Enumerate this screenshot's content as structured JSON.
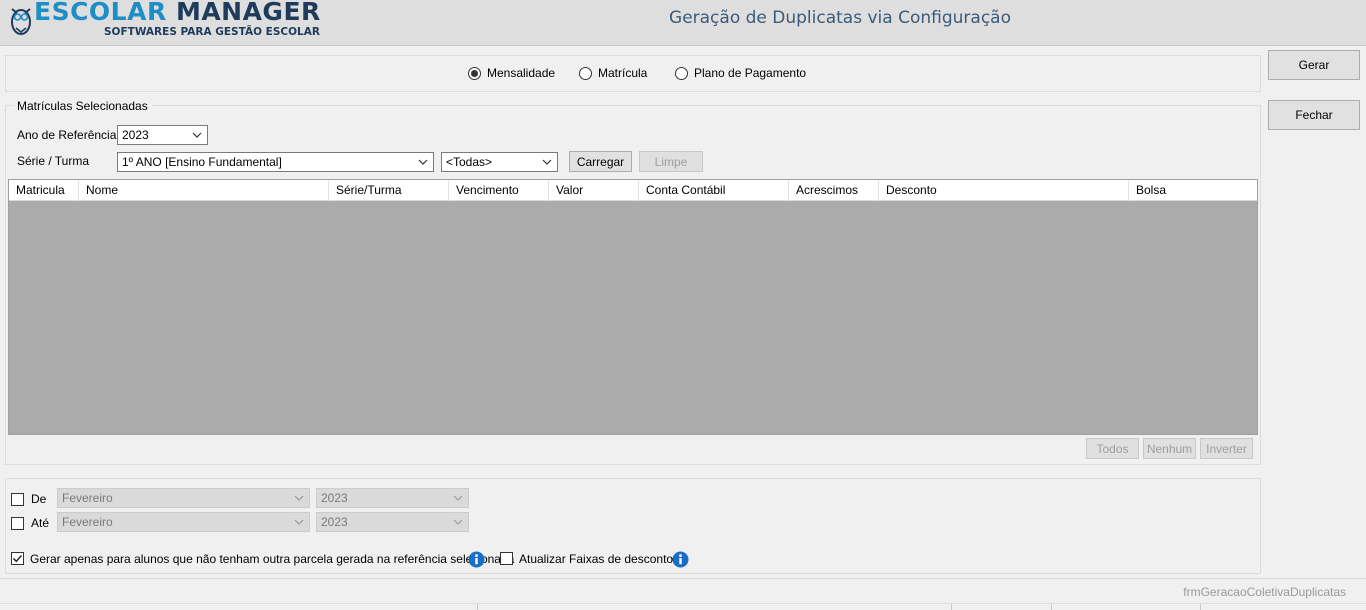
{
  "header": {
    "logo_escolar": "ESCOLAR",
    "logo_manager": "MANAGER",
    "logo_tagline": "SOFTWARES PARA GESTÃO ESCOLAR",
    "title": "Geração de Duplicatas via Configuração"
  },
  "side_buttons": {
    "gerar": "Gerar",
    "fechar": "Fechar"
  },
  "tipo": {
    "options": [
      "Mensalidade",
      "Matrícula",
      "Plano de Pagamento"
    ],
    "selected": "Mensalidade"
  },
  "matriculas": {
    "group_title": "Matrículas Selecionadas",
    "ano_label": "Ano de Referência",
    "ano_value": "2023",
    "serie_label": "Série / Turma",
    "serie_value": "1º ANO [Ensino Fundamental]",
    "turma_value": "<Todas>",
    "carregar": "Carregar",
    "limpe": "Limpe"
  },
  "grid": {
    "columns": [
      "Matricula",
      "Nome",
      "Série/Turma",
      "Vencimento",
      "Valor",
      "Conta Contábil",
      "Acrescimos",
      "Desconto",
      "Bolsa"
    ],
    "rows": []
  },
  "grid_buttons": {
    "todos": "Todos",
    "nenhum": "Nenhum",
    "inverter": "Inverter"
  },
  "periodo": {
    "de_label": "De",
    "de_mes": "Fevereiro",
    "de_ano": "2023",
    "ate_label": "Até",
    "ate_mes": "Fevereiro",
    "ate_ano": "2023"
  },
  "options": {
    "gerar_apenas": "Gerar apenas para alunos que não tenham outra parcela gerada na referência selecionada",
    "gerar_apenas_checked": true,
    "atualizar_faixas": "Atualizar Faixas de descontos.",
    "atualizar_faixas_checked": false
  },
  "status": {
    "form_name": "frmGeracaoColetivaDuplicatas"
  },
  "colors": {
    "accent_blue": "#1e8fc6",
    "dark_blue": "#1f3b5c",
    "grid_bg": "#ababab",
    "info_blue": "#1a6fc4"
  }
}
